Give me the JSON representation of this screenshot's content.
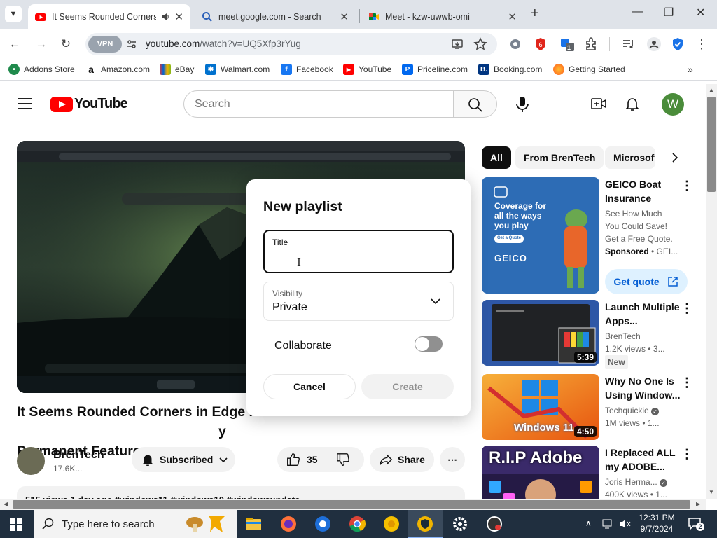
{
  "browser": {
    "tabs": [
      {
        "title": "It Seems Rounded Corners",
        "active": true
      },
      {
        "title": "meet.google.com - Search",
        "active": false
      },
      {
        "title": "Meet - kzw-uwwb-omi",
        "active": false
      }
    ],
    "url_host": "youtube.com",
    "url_path": "/watch?v=UQ5Xfp3rYug",
    "vpn_label": "VPN",
    "extension_badge_count": "1",
    "bookmarks": [
      {
        "label": "Addons Store",
        "icon": "addons-store-icon"
      },
      {
        "label": "Amazon.com",
        "icon": "amazon-icon"
      },
      {
        "label": "eBay",
        "icon": "ebay-icon"
      },
      {
        "label": "Walmart.com",
        "icon": "walmart-icon"
      },
      {
        "label": "Facebook",
        "icon": "facebook-icon"
      },
      {
        "label": "YouTube",
        "icon": "youtube-icon"
      },
      {
        "label": "Priceline.com",
        "icon": "priceline-icon"
      },
      {
        "label": "Booking.com",
        "icon": "booking-icon"
      },
      {
        "label": "Getting Started",
        "icon": "firefox-icon"
      }
    ]
  },
  "youtube": {
    "logo_text": "YouTube",
    "search_placeholder": "Search",
    "avatar_letter": "W",
    "video": {
      "title": "It Seems Rounded Corners in Edge Pr... y Permanent Feature",
      "title_line1": "It Seems Rounded Corners in Edge Pr",
      "title_line1_after": "y",
      "title_line2": "Permanent Feature",
      "channel": "BrenTech",
      "subscribers": "17.6K...",
      "subscribed_label": "Subscribed",
      "likes": "35",
      "share_label": "Share",
      "description_preview": "515 views  1 day ago  #windows11 #windows10 #windowsupdate"
    },
    "chips": [
      "All",
      "From BrenTech",
      "Microsoft"
    ],
    "recommendations": [
      {
        "title": "GEICO Boat Insurance",
        "meta1": "See How Much You Could Save! Get a Free Quote.",
        "sponsored": "Sponsored",
        "advertiser": "GEI...",
        "cta": "Get quote",
        "ad_text": "Coverage for all the ways you play",
        "ad_button": "Get a Quote",
        "ad_brand": "GEICO"
      },
      {
        "title": "Launch Multiple Apps...",
        "channel": "BrenTech",
        "stats": "1.2K views  • 3...",
        "badge": "New",
        "duration": "5:39"
      },
      {
        "title": "Why No One Is Using Window...",
        "channel": "Techquickie",
        "stats": "1M views  • 1...",
        "duration": "4:50",
        "thumb_text": "Windows 11"
      },
      {
        "title": "I Replaced ALL my ADOBE...",
        "channel": "Joris Herma...",
        "stats": "400K views  • 1...",
        "thumb_text": "R.I.P Adobe"
      }
    ]
  },
  "dialog": {
    "title": "New playlist",
    "title_field_label": "Title",
    "title_field_value": "",
    "visibility_label": "Visibility",
    "visibility_value": "Private",
    "collaborate_label": "Collaborate",
    "collaborate_on": false,
    "cancel_label": "Cancel",
    "create_label": "Create"
  },
  "taskbar": {
    "search_placeholder": "Type here to search",
    "time": "12:31 PM",
    "date": "9/7/2024",
    "notification_count": "2"
  },
  "colors": {
    "youtube_red": "#ff0000",
    "taskbar_bg": "#202f3f",
    "tabbar_bg": "#dfe3e9"
  }
}
